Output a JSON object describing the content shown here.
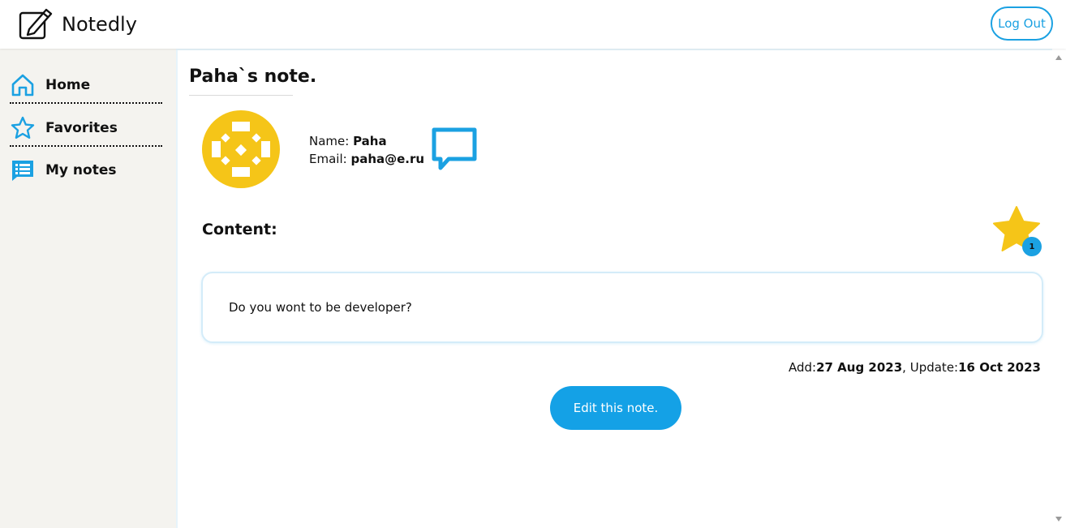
{
  "header": {
    "app_title": "Notedly",
    "logout_label": "Log Out"
  },
  "sidebar": {
    "items": [
      {
        "label": "Home",
        "icon": "home-icon"
      },
      {
        "label": "Favorites",
        "icon": "star-outline-icon"
      },
      {
        "label": "My notes",
        "icon": "notes-list-icon"
      }
    ]
  },
  "note": {
    "title": "Paha`s note.",
    "author": {
      "name_label": "Name: ",
      "name": "Paha",
      "email_label": "Email: ",
      "email": "paha@e.ru"
    },
    "content_label": "Content:",
    "content": "Do you wont to be developer?",
    "favorite_count": "1",
    "added_label": "Add:",
    "added_date": "27 Aug 2023",
    "separator": ", ",
    "updated_label": "Update:",
    "updated_date": "16 Oct 2023",
    "edit_label": "Edit this note."
  },
  "colors": {
    "accent": "#1ba1e2",
    "avatar": "#f5c518",
    "star": "#f5c518",
    "sidebar_bg": "#f4f3ef"
  }
}
